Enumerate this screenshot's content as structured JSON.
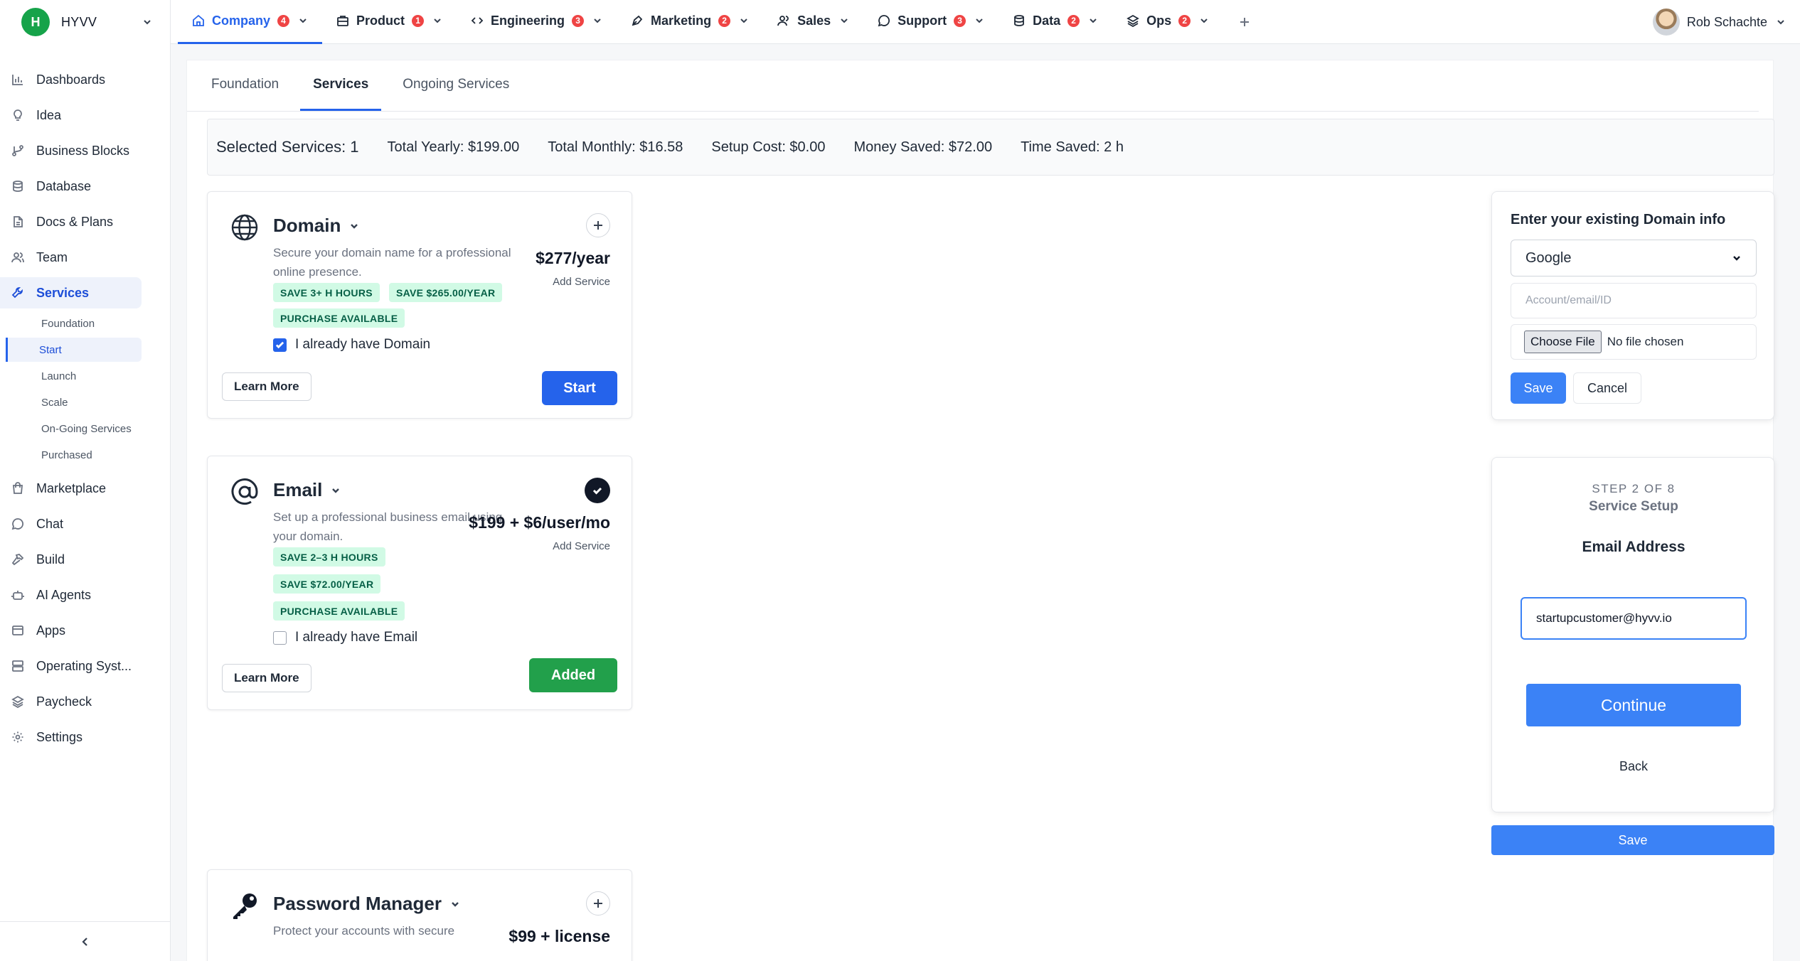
{
  "brand": {
    "initial": "H",
    "name": "HYVV"
  },
  "sidebar": {
    "items": [
      {
        "label": "Dashboards"
      },
      {
        "label": "Idea"
      },
      {
        "label": "Business Blocks"
      },
      {
        "label": "Database"
      },
      {
        "label": "Docs & Plans"
      },
      {
        "label": "Team"
      },
      {
        "label": "Services"
      },
      {
        "label": "Marketplace"
      },
      {
        "label": "Chat"
      },
      {
        "label": "Build"
      },
      {
        "label": "AI Agents"
      },
      {
        "label": "Apps"
      },
      {
        "label": "Operating Syst..."
      },
      {
        "label": "Paycheck"
      },
      {
        "label": "Settings"
      }
    ],
    "services_sub": [
      "Foundation",
      "Start",
      "Launch",
      "Scale",
      "On-Going Services",
      "Purchased"
    ]
  },
  "topnav": {
    "tabs": [
      {
        "label": "Company",
        "badge": "4"
      },
      {
        "label": "Product",
        "badge": "1"
      },
      {
        "label": "Engineering",
        "badge": "3"
      },
      {
        "label": "Marketing",
        "badge": "2"
      },
      {
        "label": "Sales",
        "badge": ""
      },
      {
        "label": "Support",
        "badge": "3"
      },
      {
        "label": "Data",
        "badge": "2"
      },
      {
        "label": "Ops",
        "badge": "2"
      }
    ],
    "user_name": "Rob Schachte"
  },
  "subtabs": [
    "Foundation",
    "Services",
    "Ongoing Services"
  ],
  "summary": {
    "selected": "Selected Services: 1",
    "yearly": "Total Yearly: $199.00",
    "monthly": "Total Monthly: $16.58",
    "setup": "Setup Cost: $0.00",
    "money_saved": "Money Saved: $72.00",
    "time_saved": "Time Saved: 2 h"
  },
  "cards": {
    "domain": {
      "title": "Domain",
      "desc": "Secure your domain name for a professional online presence.",
      "price": "$277/year",
      "add": "Add Service",
      "pills": [
        "SAVE 3+ H HOURS",
        "SAVE $265.00/YEAR",
        "PURCHASE AVAILABLE"
      ],
      "checkbox": "I already have Domain",
      "learn": "Learn More",
      "action": "Start"
    },
    "email": {
      "title": "Email",
      "desc": "Set up a professional business email using your domain.",
      "price": "$199 + $6/user/mo",
      "add": "Add Service",
      "pills": [
        "SAVE 2–3 H HOURS",
        "SAVE $72.00/YEAR",
        "PURCHASE AVAILABLE"
      ],
      "checkbox": "I already have Email",
      "learn": "Learn More",
      "action": "Added"
    },
    "password": {
      "title": "Password Manager",
      "desc": "Protect your accounts with secure",
      "price": "$99 + license"
    }
  },
  "domain_panel": {
    "title": "Enter your existing Domain info",
    "provider": "Google",
    "account_placeholder": "Account/email/ID",
    "file_button": "Choose File",
    "file_status": "No file chosen",
    "save": "Save",
    "cancel": "Cancel"
  },
  "setup_panel": {
    "step": "STEP 2 OF 8",
    "heading": "Service Setup",
    "field_label": "Email Address",
    "email_value": "startupcustomer@hyvv.io",
    "continue": "Continue",
    "back": "Back",
    "save": "Save"
  },
  "colors": {
    "primary": "#2563eb",
    "success": "#22a04b",
    "badge": "#ef4444",
    "pill_bg": "#d1fae5",
    "brand": "#16a34a"
  }
}
